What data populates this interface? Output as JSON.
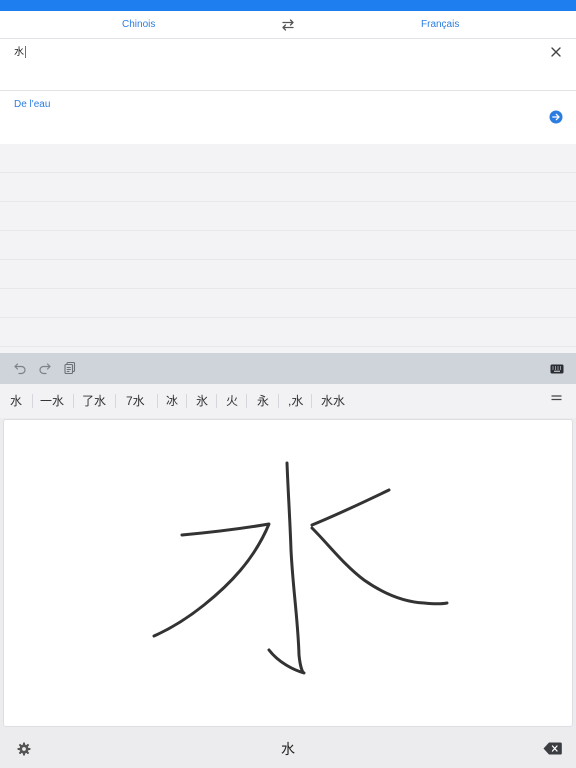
{
  "header": {
    "source_language": "Chinois",
    "target_language": "Français",
    "swap_icon": "swap-arrows-icon"
  },
  "input": {
    "text": "水",
    "clear_icon": "close-icon"
  },
  "result": {
    "translation": "De l'eau",
    "go_icon": "arrow-right-circle-icon"
  },
  "toolbar": {
    "icons": [
      "undo-icon",
      "redo-icon",
      "clipboard-icon",
      "keyboard-icon"
    ]
  },
  "candidates": {
    "items": [
      "水",
      "一水",
      "了水",
      "7水",
      "冰",
      "氷",
      "火",
      "永",
      ",水",
      "水水"
    ],
    "menu_icon": "menu-icon"
  },
  "bottom_bar": {
    "settings_icon": "gear-icon",
    "preview": "水",
    "backspace_icon": "backspace-icon"
  },
  "colors": {
    "accent": "#1e7ef0",
    "link": "#2c7de0",
    "toolbar_bg": "#cfd3da",
    "stroke": "#333333"
  }
}
